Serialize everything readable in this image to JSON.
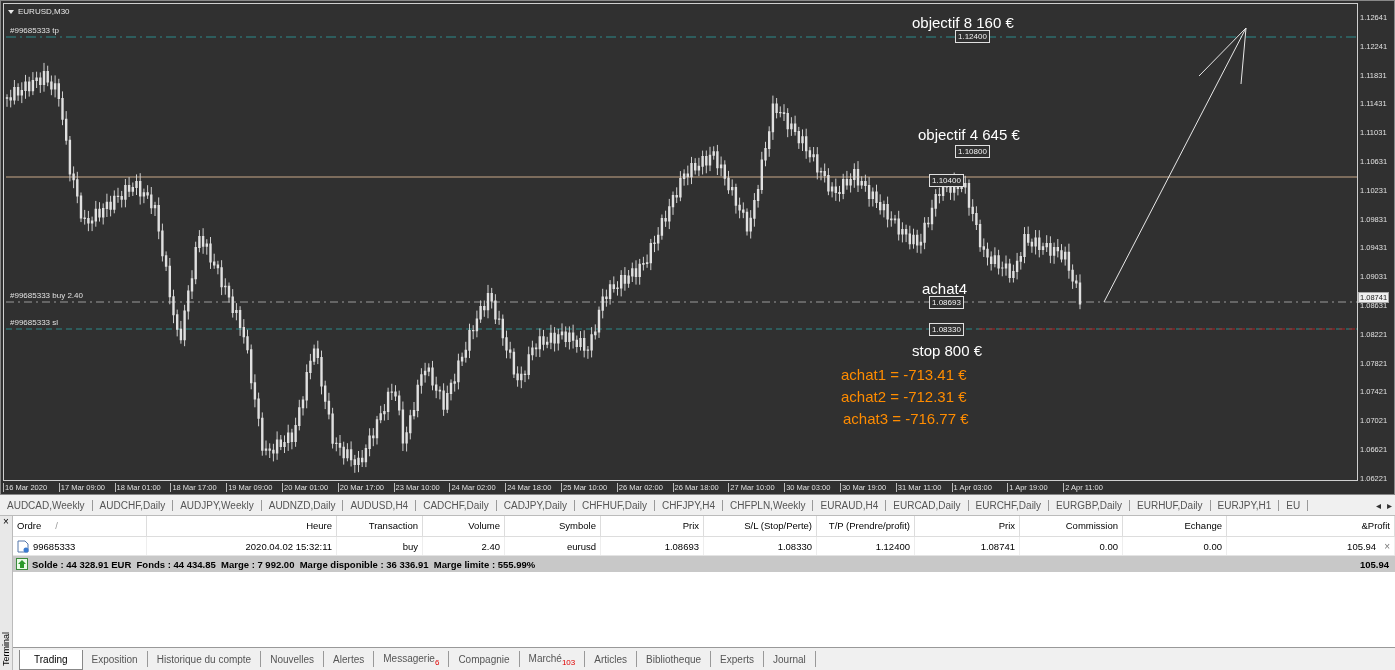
{
  "chart": {
    "title": "EURUSD,M30",
    "order_lines": [
      {
        "kind": "tp",
        "label": "#99685333 tp"
      },
      {
        "kind": "buy",
        "label": "#99685333 buy 2.40"
      },
      {
        "kind": "sl",
        "label": "#99685333 sl"
      }
    ],
    "notes": [
      {
        "kind": "target",
        "text": "objectif 8 160 €"
      },
      {
        "kind": "target",
        "text": "objectif 4 645 €"
      },
      {
        "kind": "target",
        "text": "achat4"
      },
      {
        "kind": "target",
        "text": "stop 800 €"
      },
      {
        "kind": "loss",
        "text": "achat1 = -713.41 €"
      },
      {
        "kind": "loss",
        "text": "achat2 = -712.31 €"
      },
      {
        "kind": "loss",
        "text": "achat3 = -716.77 €"
      }
    ],
    "price_boxes": [
      "1.12400",
      "1.10800",
      "1.10400",
      "1.08693",
      "1.08330"
    ],
    "price_axis": [
      "1.12641",
      "1.12241",
      "1.11831",
      "1.11431",
      "1.11031",
      "1.10631",
      "1.10231",
      "1.09831",
      "1.09431",
      "1.09031",
      "1.08631",
      "1.08221",
      "1.07821",
      "1.07421",
      "1.07021",
      "1.06621",
      "1.06221"
    ],
    "current_price": "1.08741",
    "time_axis": [
      "16 Mar 2020",
      "17 Mar 09:00",
      "18 Mar 01:00",
      "18 Mar 17:00",
      "19 Mar 09:00",
      "20 Mar 01:00",
      "20 Mar 17:00",
      "23 Mar 10:00",
      "24 Mar 02:00",
      "24 Mar 18:00",
      "25 Mar 10:00",
      "26 Mar 02:00",
      "26 Mar 18:00",
      "27 Mar 10:00",
      "30 Mar 03:00",
      "30 Mar 19:00",
      "31 Mar 11:00",
      "1 Apr 03:00",
      "1 Apr 19:00",
      "2 Apr 11:00"
    ]
  },
  "symbol_tabs": [
    "AUDCAD,Weekly",
    "AUDCHF,Daily",
    "AUDJPY,Weekly",
    "AUDNZD,Daily",
    "AUDUSD,H4",
    "CADCHF,Daily",
    "CADJPY,Daily",
    "CHFHUF,Daily",
    "CHFJPY,H4",
    "CHFPLN,Weekly",
    "EURAUD,H4",
    "EURCAD,Daily",
    "EURCHF,Daily",
    "EURGBP,Daily",
    "EURHUF,Daily",
    "EURJPY,H1",
    "EU"
  ],
  "tab_scroll": [
    "◂",
    "▸"
  ],
  "terminal": {
    "title": "Terminal",
    "close": "×",
    "columns": [
      "Ordre",
      "Heure",
      "Transaction",
      "Volume",
      "Symbole",
      "Prix",
      "S/L (Stop/Perte)",
      "T/P (Prendre/profit)",
      "Prix",
      "Commission",
      "Echange",
      "&Profit"
    ],
    "sort_mark": "/",
    "rows": [
      {
        "cells": [
          "99685333",
          "2020.04.02 15:32:11",
          "buy",
          "2.40",
          "eurusd",
          "1.08693",
          "1.08330",
          "1.12400",
          "1.08741",
          "0.00",
          "0.00",
          "105.94"
        ],
        "close": "×"
      }
    ],
    "balance": "Solde : 44 328.91 EUR  Fonds : 44 434.85  Marge : 7 992.00  Marge disponible : 36 336.91  Marge limite : 555.99%",
    "balance_total": "105.94",
    "tabs": [
      {
        "label": "Trading",
        "selected": true
      },
      {
        "label": "Exposition",
        "selected": false
      },
      {
        "label": "Historique du compte",
        "selected": false
      },
      {
        "label": "Nouvelles",
        "selected": false
      },
      {
        "label": "Alertes",
        "selected": false
      },
      {
        "label": "Messagerie",
        "badge": "6",
        "selected": false
      },
      {
        "label": "Compagnie",
        "selected": false
      },
      {
        "label": "Marché",
        "badge": "103",
        "selected": false
      },
      {
        "label": "Articles",
        "selected": false
      },
      {
        "label": "Bibliotheque",
        "selected": false
      },
      {
        "label": "Experts",
        "selected": false
      },
      {
        "label": "Journal",
        "selected": false
      }
    ]
  }
}
